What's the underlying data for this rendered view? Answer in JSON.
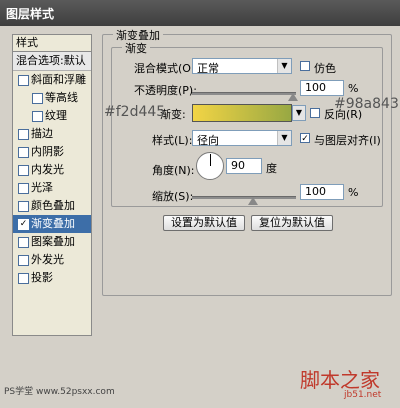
{
  "window": {
    "title": "图层样式"
  },
  "sidebar": {
    "header": "样式",
    "blend_options": "混合选项:默认",
    "items": [
      {
        "label": "斜面和浮雕",
        "checked": false,
        "sub": false,
        "active": false
      },
      {
        "label": "等高线",
        "checked": false,
        "sub": true,
        "active": false
      },
      {
        "label": "纹理",
        "checked": false,
        "sub": true,
        "active": false
      },
      {
        "label": "描边",
        "checked": false,
        "sub": false,
        "active": false
      },
      {
        "label": "内阴影",
        "checked": false,
        "sub": false,
        "active": false
      },
      {
        "label": "内发光",
        "checked": false,
        "sub": false,
        "active": false
      },
      {
        "label": "光泽",
        "checked": false,
        "sub": false,
        "active": false
      },
      {
        "label": "颜色叠加",
        "checked": false,
        "sub": false,
        "active": false
      },
      {
        "label": "渐变叠加",
        "checked": true,
        "sub": false,
        "active": true
      },
      {
        "label": "图案叠加",
        "checked": false,
        "sub": false,
        "active": false
      },
      {
        "label": "外发光",
        "checked": false,
        "sub": false,
        "active": false
      },
      {
        "label": "投影",
        "checked": false,
        "sub": false,
        "active": false
      }
    ]
  },
  "panel": {
    "outer_legend": "渐变叠加",
    "inner_legend": "渐变",
    "blend_mode_label": "混合模式(O):",
    "blend_mode_value": "正常",
    "dither_label": "仿色",
    "opacity_label": "不透明度(P):",
    "opacity_value": "100",
    "percent": "%",
    "gradient_label": "渐变:",
    "reverse_label": "反向(R)",
    "style_label": "样式(L):",
    "style_value": "径向",
    "align_label": "与图层对齐(I)",
    "angle_label": "角度(N):",
    "angle_value": "90",
    "degree_unit": "度",
    "scale_label": "缩放(S):",
    "scale_value": "100",
    "reset_default_button": "设置为默认值",
    "restore_default_button": "复位为默认值",
    "gradient_colors": {
      "start": "#f2d445",
      "end": "#98a843"
    }
  },
  "annotations": {
    "left_color": "#f2d445",
    "right_color": "#98a843"
  },
  "watermark": {
    "left": "PS学堂 www.52psxx.com",
    "right": "脚本之家",
    "right_sub": "jb51.net"
  }
}
